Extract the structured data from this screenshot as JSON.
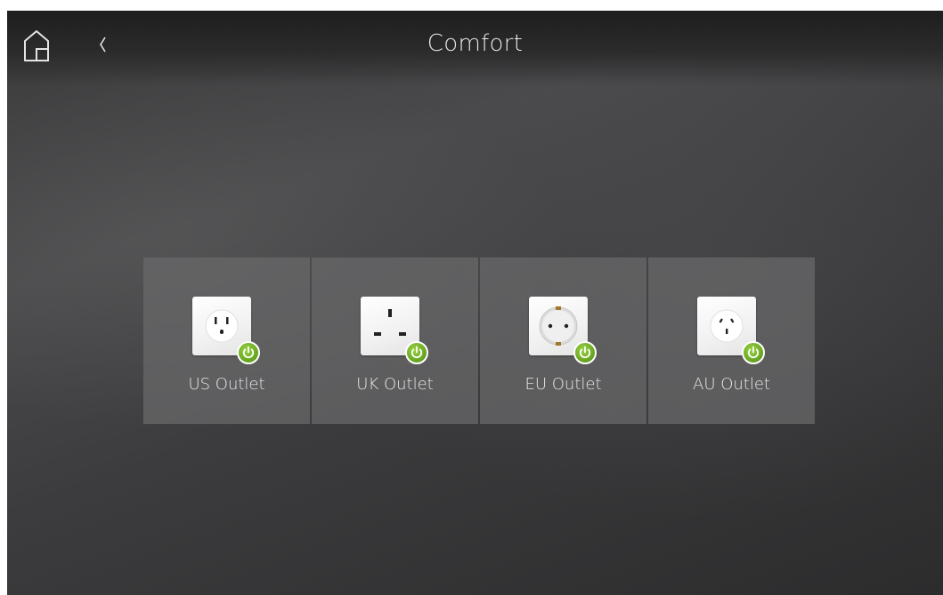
{
  "header": {
    "title": "Comfort",
    "home_icon": "home-icon",
    "back_icon": "chevron-left-icon"
  },
  "outlets": [
    {
      "label": "US Outlet",
      "icon": "us-outlet-icon",
      "status": "on"
    },
    {
      "label": "UK Outlet",
      "icon": "uk-outlet-icon",
      "status": "on"
    },
    {
      "label": "EU Outlet",
      "icon": "eu-outlet-icon",
      "status": "on"
    },
    {
      "label": "AU Outlet",
      "icon": "au-outlet-icon",
      "status": "on"
    }
  ],
  "colors": {
    "power_on": "#6fad25",
    "text": "#e8e8e8"
  }
}
